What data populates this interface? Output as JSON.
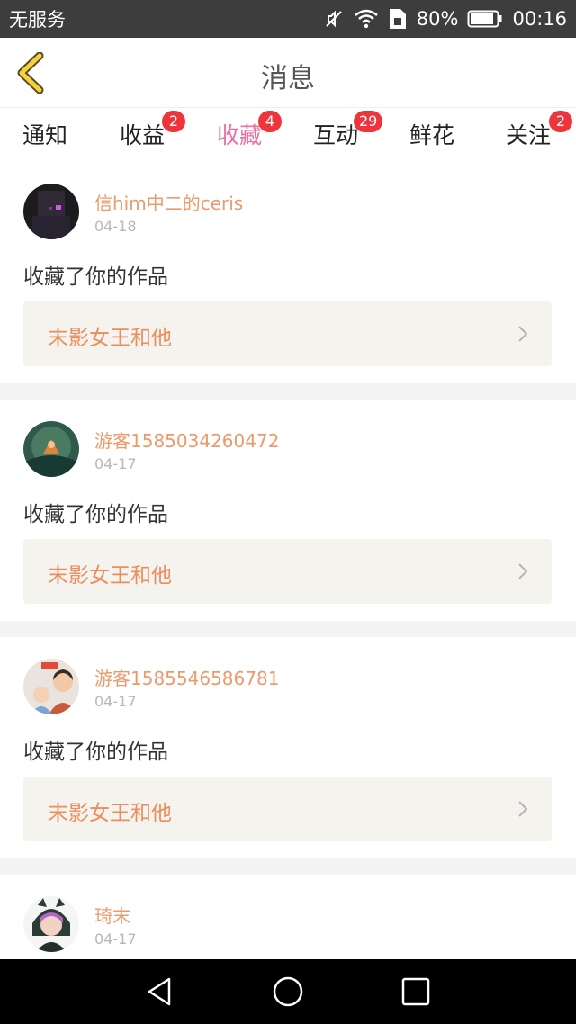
{
  "status_bar": {
    "carrier": "无服务",
    "battery": "80%",
    "time": "00:16",
    "icons": [
      "mute-icon",
      "wifi-icon",
      "sim-icon",
      "battery-icon"
    ]
  },
  "header": {
    "title": "消息",
    "back_icon": "chevron-left-icon",
    "accent_color": "#ec6fa4"
  },
  "tabs": [
    {
      "label": "通知",
      "badge": "",
      "active": false
    },
    {
      "label": "收益",
      "badge": "2",
      "active": false
    },
    {
      "label": "收藏",
      "badge": "4",
      "active": true
    },
    {
      "label": "互动",
      "badge": "29",
      "active": false
    },
    {
      "label": "鲜花",
      "badge": "",
      "active": false
    },
    {
      "label": "关注",
      "badge": "2",
      "active": false
    }
  ],
  "feed": [
    {
      "user": "信him中二的ceris",
      "date": "04-18",
      "action": "收藏了你的作品",
      "work": "末影女王和他"
    },
    {
      "user": "游客1585034260472",
      "date": "04-17",
      "action": "收藏了你的作品",
      "work": "末影女王和他"
    },
    {
      "user": "游客1585546586781",
      "date": "04-17",
      "action": "收藏了你的作品",
      "work": "末影女王和他"
    },
    {
      "user": "琦末",
      "date": "04-17"
    }
  ],
  "nav_bar": {
    "icons": [
      "back-triangle-icon",
      "home-circle-icon",
      "recents-square-icon"
    ]
  }
}
